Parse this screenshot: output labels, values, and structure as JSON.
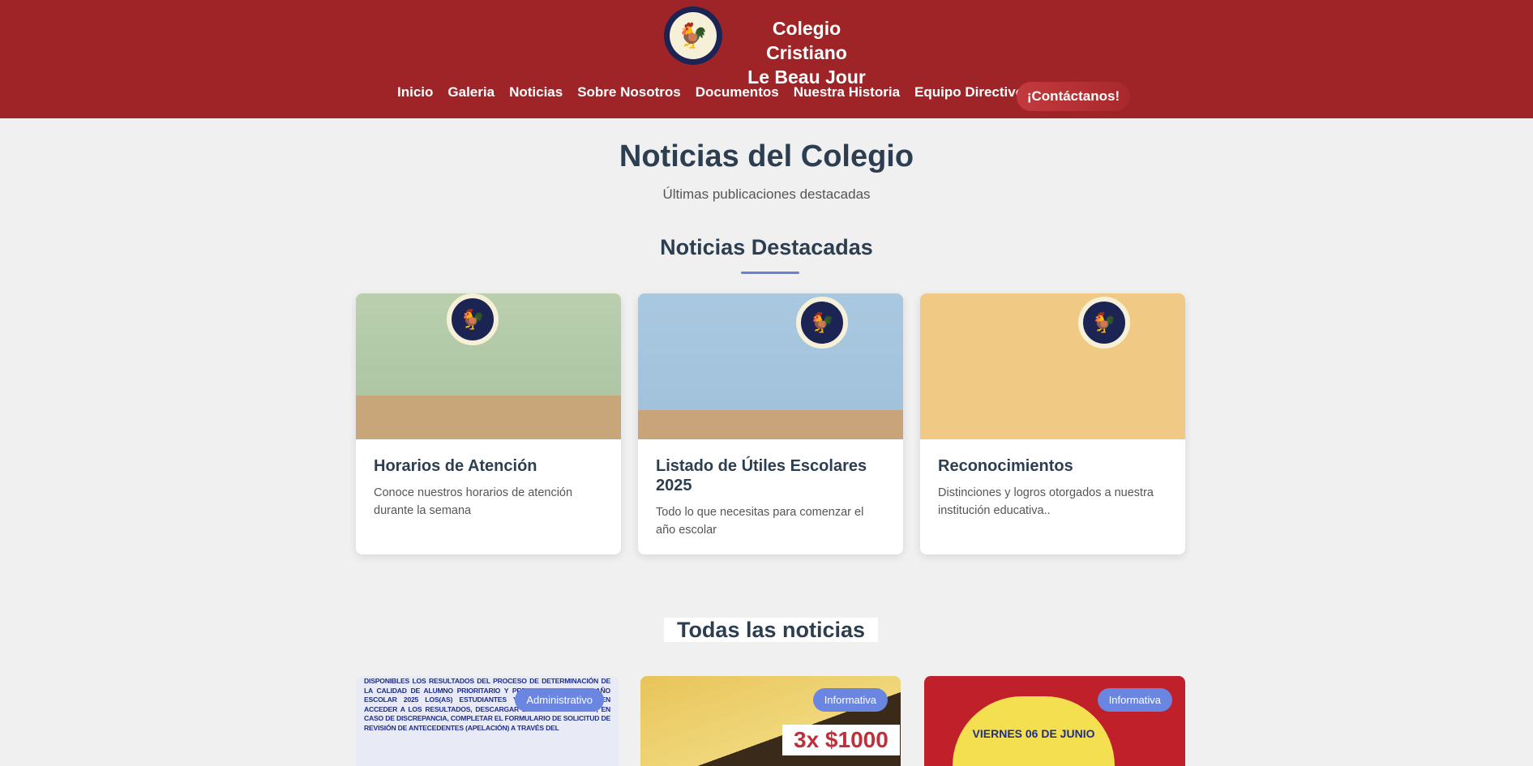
{
  "header": {
    "brand_line1": "Colegio Cristiano",
    "brand_line2": "Le Beau Jour",
    "nav": [
      "Inicio",
      "Galeria",
      "Noticias",
      "Sobre Nosotros",
      "Documentos",
      "Nuestra Historia",
      "Equipo Directivo"
    ],
    "contact_label": "¡Contáctanos!"
  },
  "page": {
    "title": "Noticias del Colegio",
    "subtitle": "Últimas publicaciones destacadas"
  },
  "featured": {
    "heading": "Noticias Destacadas",
    "cards": [
      {
        "title": "Horarios de Atención",
        "description": "Conoce nuestros horarios de atención durante la semana"
      },
      {
        "title": "Listado de Útiles Escolares 2025",
        "description": "Todo lo que necesitas para comenzar el año escolar"
      },
      {
        "title": "Reconocimientos",
        "description": "Distinciones y logros otorgados a nuestra institución educativa.."
      }
    ]
  },
  "all_news": {
    "heading": "Todas las noticias",
    "cards": [
      {
        "badge": "Administrativo",
        "image_text": "DISPONIBLES LOS RESULTADOS DEL PROCESO DE DETERMINACIÓN DE LA CALIDAD DE ALUMNO PRIORITARIO Y PREFERENTE PARA EL AÑO ESCOLAR 2025 LOS(AS) ESTUDIANTES Y SUS FAMILIAS PUEDEN ACCEDER A LOS RESULTADOS, DESCARGAR LOS CERTIFICADOS Y, EN CASO DE DISCREPANCIA, COMPLETAR EL FORMULARIO DE SOLICITUD DE REVISIÓN DE ANTECEDENTES (APELACIÓN) A TRAVÉS DEL"
      },
      {
        "badge": "Informativa",
        "image_text": "3x $1000"
      },
      {
        "badge": "Informativa",
        "image_text": "VIERNES 06 DE JUNIO"
      }
    ]
  }
}
